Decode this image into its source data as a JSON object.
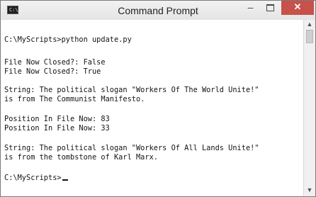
{
  "window": {
    "title": "Command Prompt",
    "icon_label": "C:\\",
    "controls": {
      "minimize": "–",
      "close": "✕"
    }
  },
  "console": {
    "lines": [
      "C:\\MyScripts>python update.py",
      "",
      "File Now Closed?: False",
      "File Now Closed?: True",
      "",
      "String: The political slogan \"Workers Of The World Unite!\"",
      "is from The Communist Manifesto.",
      "",
      "Position In File Now: 83",
      "Position In File Now: 33",
      "",
      "String: The political slogan \"Workers Of All Lands Unite!\"",
      "is from the tombstone of Karl Marx.",
      "",
      "C:\\MyScripts>"
    ]
  },
  "scrollbar": {
    "up_arrow": "▲",
    "down_arrow": "▼"
  }
}
